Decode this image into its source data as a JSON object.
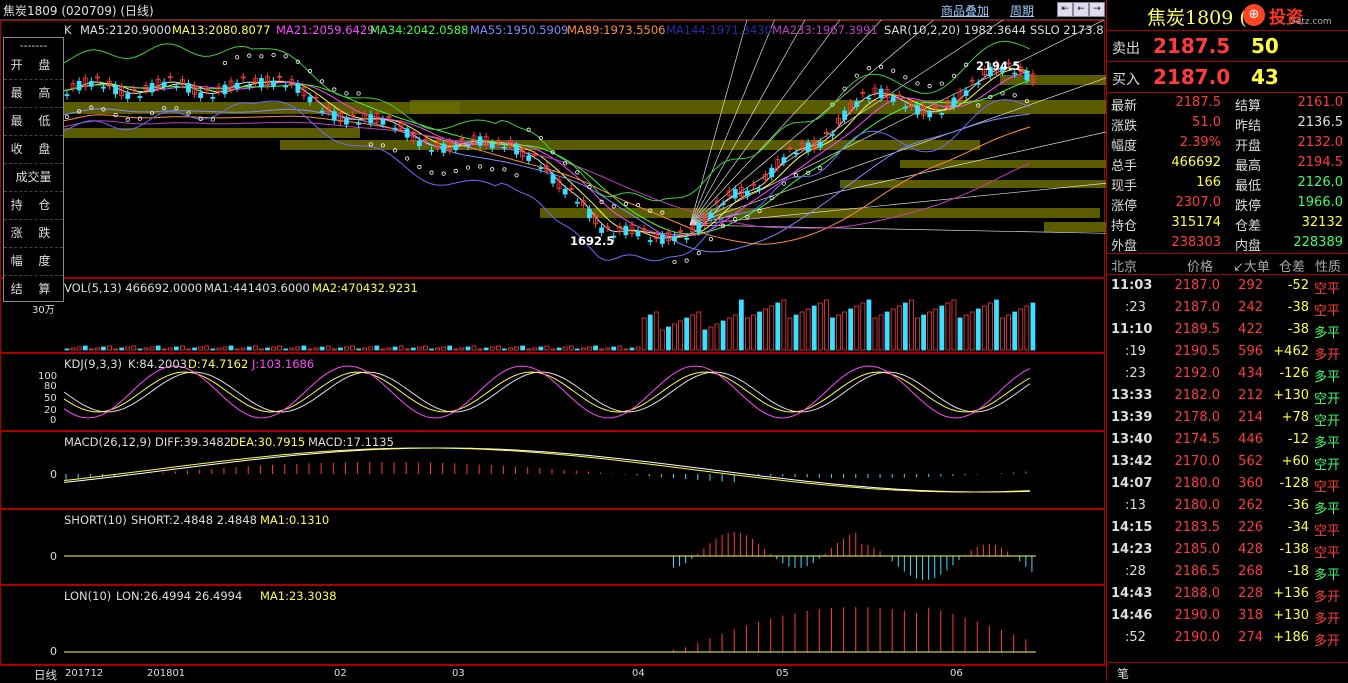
{
  "title_bar": {
    "title": "焦炭1809 (020709) (日线)",
    "overlay_btn": "商品叠加",
    "period_btn": "周期"
  },
  "main_legend": {
    "k": "K",
    "ma5": "MA5:2120.9000",
    "ma13": "MA13:2080.8077",
    "ma21": "MA21:2059.6429",
    "ma34": "MA34:2042.0588",
    "ma55": "MA55:1950.5909",
    "ma89": "MA89:1973.5506",
    "ma144": "MA144:1971.3430",
    "ma233": "MA233:1967.3991",
    "sar": "SAR(10,2,20) 1982.3644",
    "sslo": "SSLO 2173.8"
  },
  "annotations": {
    "high": "2194.5",
    "low": "1692.5"
  },
  "vol_legend": {
    "name": "VOL(5,13) 466692.0000",
    "ma1": "MA1:441403.6000",
    "ma2": "MA2:470432.9231",
    "axis": "30万"
  },
  "kdj_legend": {
    "name": "KDJ(9,3,3)",
    "k": "K:84.2003",
    "d": "D:74.7162",
    "j": "J:103.1686",
    "ticks": [
      "100",
      "80",
      "50",
      "20",
      "0"
    ]
  },
  "macd_legend": {
    "name": "MACD(26,12,9)",
    "diff": "DIFF:39.3482",
    "dea": "DEA:30.7915",
    "macd": "MACD:17.1135",
    "zero": "0"
  },
  "short_legend": {
    "name": "SHORT(10)",
    "short": "SHORT:2.4848 2.4848",
    "ma1": "MA1:0.1310",
    "zero": "0"
  },
  "lon_legend": {
    "name": "LON(10)",
    "lon": "LON:26.4994 26.4994",
    "ma1": "MA1:23.3038",
    "zero": "0"
  },
  "popup": {
    "header": "-------",
    "items": [
      "开 盘",
      "最 高",
      "最 低",
      "收 盘",
      "成交量",
      "持 仓",
      "涨 跌",
      "幅 度",
      "结 算"
    ]
  },
  "time_axis": {
    "period": "日线",
    "labels": [
      "201712",
      "201801",
      "02",
      "03",
      "04",
      "05",
      "06"
    ]
  },
  "quote": {
    "name": "焦炭1809 (",
    "brand": "投资",
    "brand_url": "5etz.com",
    "ask_label": "卖出",
    "ask_price": "2187.5",
    "ask_vol": "50",
    "bid_label": "买入",
    "bid_price": "2187.0",
    "bid_vol": "43",
    "rows": [
      {
        "l1": "最新",
        "v1": "2187.5",
        "c1": "#ff3b3b",
        "l2": "结算",
        "v2": "2161.0",
        "c2": "#ff3b3b"
      },
      {
        "l1": "涨跌",
        "v1": "51.0",
        "c1": "#ff3b3b",
        "l2": "昨结",
        "v2": "2136.5",
        "c2": "#e0e0e0"
      },
      {
        "l1": "幅度",
        "v1": "2.39%",
        "c1": "#ff3b3b",
        "l2": "开盘",
        "v2": "2132.0",
        "c2": "#ff3b3b"
      },
      {
        "l1": "总手",
        "v1": "466692",
        "c1": "#ffff3b",
        "l2": "最高",
        "v2": "2194.5",
        "c2": "#ff3b3b"
      },
      {
        "l1": "现手",
        "v1": "166",
        "c1": "#ffff3b",
        "l2": "最低",
        "v2": "2126.0",
        "c2": "#3bff6b"
      },
      {
        "l1": "涨停",
        "v1": "2307.0",
        "c1": "#ff3b3b",
        "l2": "跌停",
        "v2": "1966.0",
        "c2": "#3bff6b"
      },
      {
        "l1": "持仓",
        "v1": "315174",
        "c1": "#ffff3b",
        "l2": "仓差",
        "v2": "32132",
        "c2": "#ffff3b"
      },
      {
        "l1": "外盘",
        "v1": "238303",
        "c1": "#ff3b3b",
        "l2": "内盘",
        "v2": "228389",
        "c2": "#3bff6b"
      }
    ]
  },
  "ticks_header": {
    "time": "北京",
    "price": "价格",
    "vol": "↙大单",
    "oi": "仓差",
    "nature": "性质"
  },
  "ticks": [
    {
      "t": "11:03",
      "p": "2187.0",
      "v": "292",
      "oi": "-52",
      "n": "空平",
      "nc": "#ff3b3b"
    },
    {
      "t": ":23",
      "p": "2187.0",
      "v": "242",
      "oi": "-38",
      "n": "空平",
      "nc": "#ff3b3b"
    },
    {
      "t": "11:10",
      "p": "2189.5",
      "v": "422",
      "oi": "-38",
      "n": "多平",
      "nc": "#3bff6b"
    },
    {
      "t": ":19",
      "p": "2190.5",
      "v": "596",
      "oi": "+462",
      "n": "多开",
      "nc": "#ff3b3b"
    },
    {
      "t": ":23",
      "p": "2192.0",
      "v": "434",
      "oi": "-126",
      "n": "多平",
      "nc": "#3bff6b"
    },
    {
      "t": "13:33",
      "p": "2182.0",
      "v": "212",
      "oi": "+130",
      "n": "空开",
      "nc": "#3bff6b"
    },
    {
      "t": "13:39",
      "p": "2178.0",
      "v": "214",
      "oi": "+78",
      "n": "空开",
      "nc": "#3bff6b"
    },
    {
      "t": "13:40",
      "p": "2174.5",
      "v": "446",
      "oi": "-12",
      "n": "多平",
      "nc": "#3bff6b"
    },
    {
      "t": "13:42",
      "p": "2170.0",
      "v": "562",
      "oi": "+60",
      "n": "空开",
      "nc": "#3bff6b"
    },
    {
      "t": "14:07",
      "p": "2180.0",
      "v": "360",
      "oi": "-128",
      "n": "空平",
      "nc": "#ff3b3b"
    },
    {
      "t": ":13",
      "p": "2180.0",
      "v": "262",
      "oi": "-36",
      "n": "多平",
      "nc": "#3bff6b"
    },
    {
      "t": "14:15",
      "p": "2183.5",
      "v": "226",
      "oi": "-34",
      "n": "空平",
      "nc": "#ff3b3b"
    },
    {
      "t": "14:23",
      "p": "2185.0",
      "v": "428",
      "oi": "-138",
      "n": "空平",
      "nc": "#ff3b3b"
    },
    {
      "t": ":28",
      "p": "2186.5",
      "v": "268",
      "oi": "-18",
      "n": "多平",
      "nc": "#3bff6b"
    },
    {
      "t": "14:43",
      "p": "2188.0",
      "v": "228",
      "oi": "+136",
      "n": "多开",
      "nc": "#ff3b3b"
    },
    {
      "t": "14:46",
      "p": "2190.0",
      "v": "318",
      "oi": "+130",
      "n": "多开",
      "nc": "#ff3b3b"
    },
    {
      "t": ":52",
      "p": "2190.0",
      "v": "274",
      "oi": "+186",
      "n": "多开",
      "nc": "#ff3b3b"
    }
  ],
  "bottom_tab": "笔"
}
